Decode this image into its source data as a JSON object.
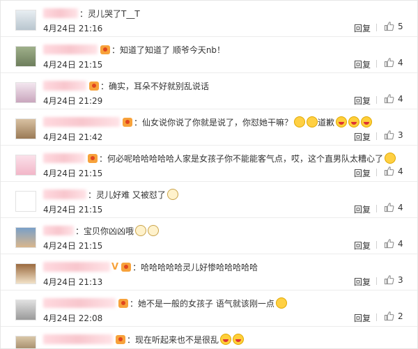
{
  "labels": {
    "reply": "回复"
  },
  "comments": [
    {
      "text": "灵儿哭了T__T",
      "time": "4月24日 21:16",
      "likes": "5",
      "badge": false,
      "emojis": [],
      "trailing": ""
    },
    {
      "text": "知道了知道了 顺爷今天nb！",
      "time": "4月24日 21:15",
      "likes": "4",
      "badge": true,
      "emojis": [],
      "trailing": ""
    },
    {
      "text": "确实，耳朵不好就别乱说话",
      "time": "4月24日 21:29",
      "likes": "4",
      "badge": true,
      "emojis": [],
      "trailing": ""
    },
    {
      "text": "仙女说你说了你就是说了，你怼她干嘛？",
      "time": "4月24日 21:42",
      "likes": "3",
      "badge": true,
      "emojis": [
        "smile-emoji",
        "smile-emoji"
      ],
      "trailing": "道歉",
      "trailing_emojis": [
        "laugh-emoji",
        "laugh-emoji",
        "laugh-emoji"
      ]
    },
    {
      "text": "何必呢哈哈哈哈哈人家是女孩子你不能能客气点，哎，这个直男队太糟心了",
      "time": "4月24日 21:15",
      "likes": "4",
      "badge": true,
      "emojis": [
        "sad-emoji"
      ],
      "trailing": ""
    },
    {
      "text": "灵儿好难 又被怼了",
      "time": "4月24日 21:15",
      "likes": "4",
      "badge": false,
      "emojis": [
        "cat-emoji"
      ],
      "trailing": ""
    },
    {
      "text": "宝贝你凶凶哦",
      "time": "4月24日 21:15",
      "likes": "4",
      "badge": false,
      "emojis": [
        "cat-emoji",
        "cat-emoji"
      ],
      "trailing": ""
    },
    {
      "text": "哈哈哈哈哈灵儿好惨哈哈哈哈哈",
      "time": "4月24日 21:13",
      "likes": "3",
      "badge": true,
      "verified": true,
      "emojis": [],
      "trailing": ""
    },
    {
      "text": "她不是一般的女孩子 语气就该刚一点",
      "time": "4月24日 22:08",
      "likes": "2",
      "badge": true,
      "emojis": [
        "smile-emoji"
      ],
      "trailing": ""
    },
    {
      "text": "现在听起来也不是很乱",
      "time": "",
      "likes": "",
      "badge": true,
      "emojis": [
        "laugh-emoji",
        "laugh-emoji"
      ],
      "trailing": ""
    }
  ]
}
